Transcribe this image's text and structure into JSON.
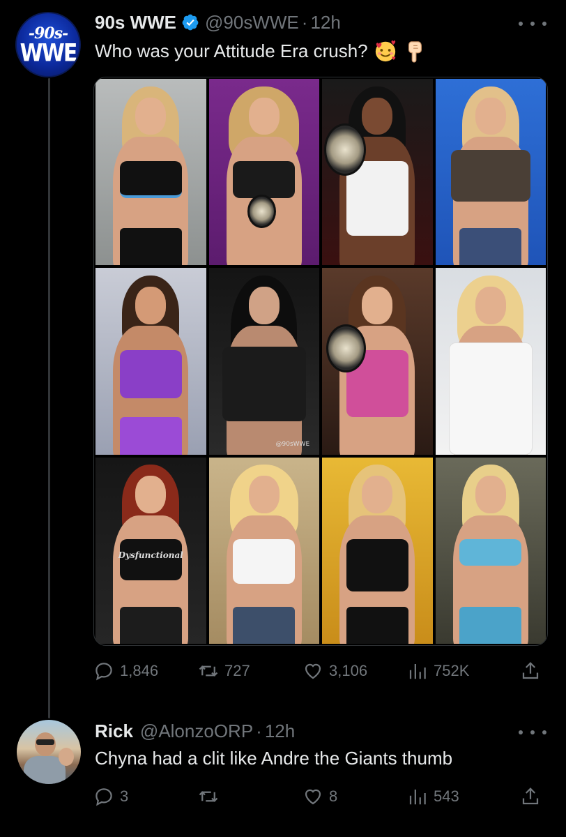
{
  "tweet": {
    "author_name": "90s WWE",
    "handle": "@90sWWE",
    "separator": "·",
    "time": "12h",
    "text": "Who was your Attitude Era crush?",
    "emojis": [
      "smiling-face-with-hearts",
      "backhand-index-pointing-down"
    ],
    "avatar_text_top": "-90s-",
    "avatar_text_bottom": "WWE",
    "verified": true,
    "media_watermark": "@90sWWE",
    "media_shirt_text": "Dysfunctional",
    "stats": {
      "replies": "1,846",
      "retweets": "727",
      "likes": "3,106",
      "views": "752K"
    }
  },
  "reply": {
    "author_name": "Rick",
    "handle": "@AlonzoORP",
    "separator": "·",
    "time": "12h",
    "text": "Chyna had a clit like Andre the Giants thumb",
    "stats": {
      "replies": "3",
      "retweets": "",
      "likes": "8",
      "views": "543"
    }
  },
  "colors": {
    "background": "#000000",
    "text_primary": "#e7e9ea",
    "text_secondary": "#71767b",
    "verified_blue": "#1d9bf0",
    "divider": "#2f3336"
  },
  "icons": [
    "reply-icon",
    "retweet-icon",
    "like-icon",
    "views-icon",
    "share-icon",
    "more-icon",
    "verified-badge-icon"
  ]
}
